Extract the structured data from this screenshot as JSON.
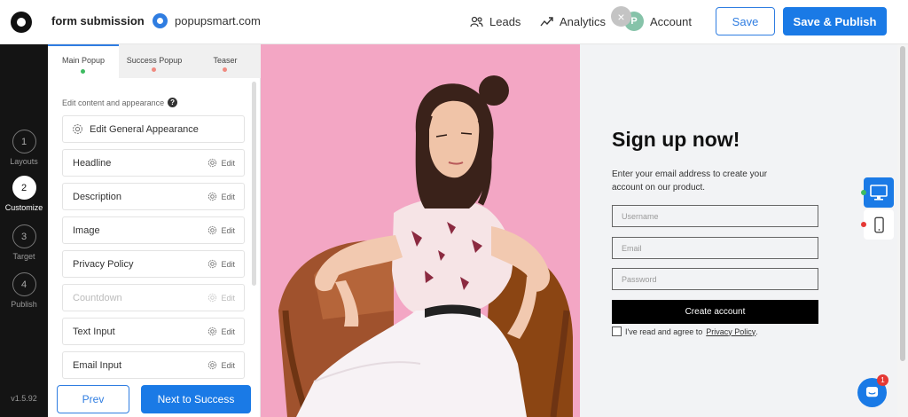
{
  "header": {
    "form_title": "form submission",
    "site_name": "popupsmart.com",
    "nav": [
      {
        "label": "Leads",
        "icon": "leads-icon"
      },
      {
        "label": "Analytics",
        "icon": "analytics-icon"
      }
    ],
    "account": {
      "avatar_letter": "P",
      "label": "Account"
    },
    "save_label": "Save",
    "publish_label": "Save & Publish"
  },
  "steps": [
    {
      "number": "1",
      "label": "Layouts",
      "active": false
    },
    {
      "number": "2",
      "label": "Customize",
      "active": true
    },
    {
      "number": "3",
      "label": "Target",
      "active": false
    },
    {
      "number": "4",
      "label": "Publish",
      "active": false
    }
  ],
  "version": "v1.5.92",
  "editor": {
    "tabs": [
      {
        "label": "Main Popup",
        "dot_color": "#3dbb61",
        "active": true
      },
      {
        "label": "Success Popup",
        "dot_color": "#f08a80",
        "active": false
      },
      {
        "label": "Teaser",
        "dot_color": "#f08a80",
        "active": false
      }
    ],
    "section_title": "Edit content and appearance",
    "help_icon": "?",
    "general_item": "Edit General Appearance",
    "edit_label": "Edit",
    "items": [
      {
        "label": "Headline",
        "disabled": false
      },
      {
        "label": "Description",
        "disabled": false
      },
      {
        "label": "Image",
        "disabled": false
      },
      {
        "label": "Privacy Policy",
        "disabled": false
      },
      {
        "label": "Countdown",
        "disabled": true
      },
      {
        "label": "Text Input",
        "disabled": false
      },
      {
        "label": "Email Input",
        "disabled": false
      }
    ],
    "prev_label": "Prev",
    "next_label": "Next to Success"
  },
  "popup": {
    "title": "Sign up now!",
    "description": "Enter your email address to create your account on our product.",
    "inputs": [
      {
        "placeholder": "Username"
      },
      {
        "placeholder": "Email"
      },
      {
        "placeholder": "Password"
      }
    ],
    "button_label": "Create account",
    "consent_text": "I've read and agree to",
    "consent_link": "Privacy Policy",
    "consent_end": ".",
    "close_symbol": "×"
  },
  "device_switch": {
    "desktop_dot": "#3dbb61",
    "mobile_dot": "#e53935"
  },
  "chat": {
    "badge": "1"
  },
  "colors": {
    "accent": "#1a7ae6",
    "rail": "#141414",
    "photo_bg": "#f3a6c4"
  }
}
